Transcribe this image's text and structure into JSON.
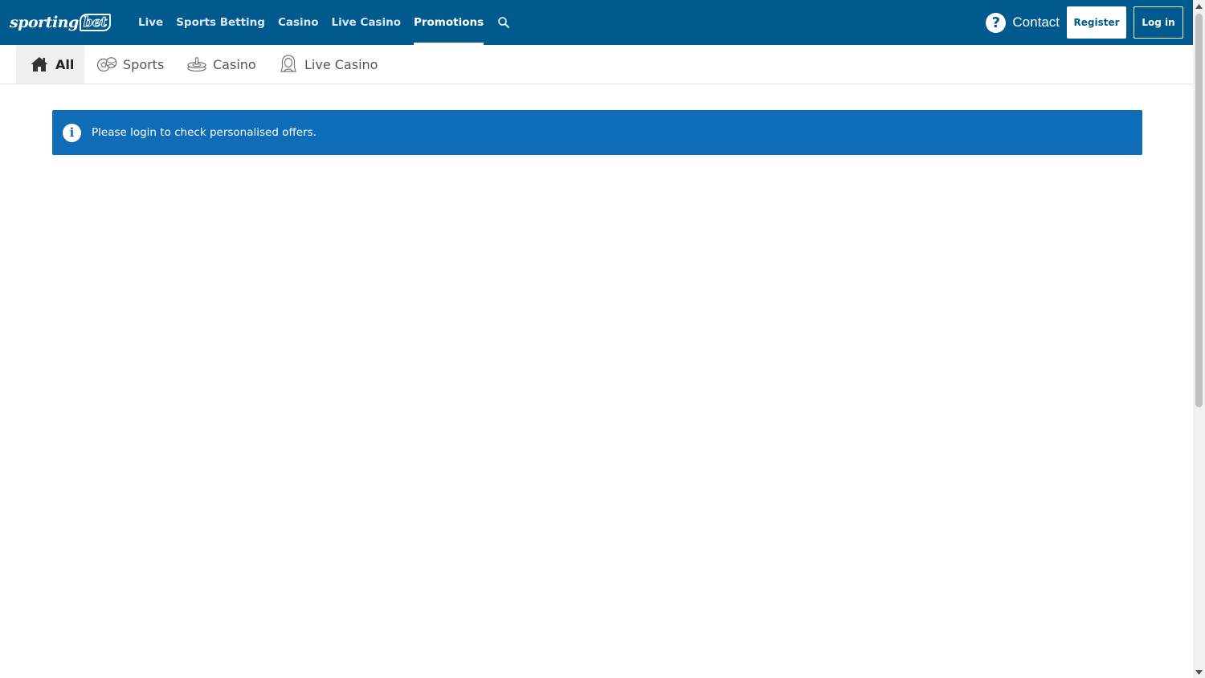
{
  "header": {
    "logo_main": "sporting",
    "logo_suffix": "bet",
    "nav": [
      {
        "label": "Live"
      },
      {
        "label": "Sports Betting"
      },
      {
        "label": "Casino"
      },
      {
        "label": "Live Casino"
      },
      {
        "label": "Promotions",
        "active": true
      }
    ],
    "contact_label": "Contact",
    "register_label": "Register",
    "login_label": "Log in"
  },
  "subtabs": [
    {
      "label": "All",
      "icon": "home-icon",
      "active": true
    },
    {
      "label": "Sports",
      "icon": "sports-balls-icon"
    },
    {
      "label": "Casino",
      "icon": "casino-chips-icon"
    },
    {
      "label": "Live Casino",
      "icon": "dealer-icon"
    }
  ],
  "banner": {
    "icon": "info-icon",
    "message": "Please login to check personalised offers."
  },
  "colors": {
    "brand_blue": "#015a8e",
    "banner_blue": "#0f6db8",
    "white": "#ffffff"
  }
}
